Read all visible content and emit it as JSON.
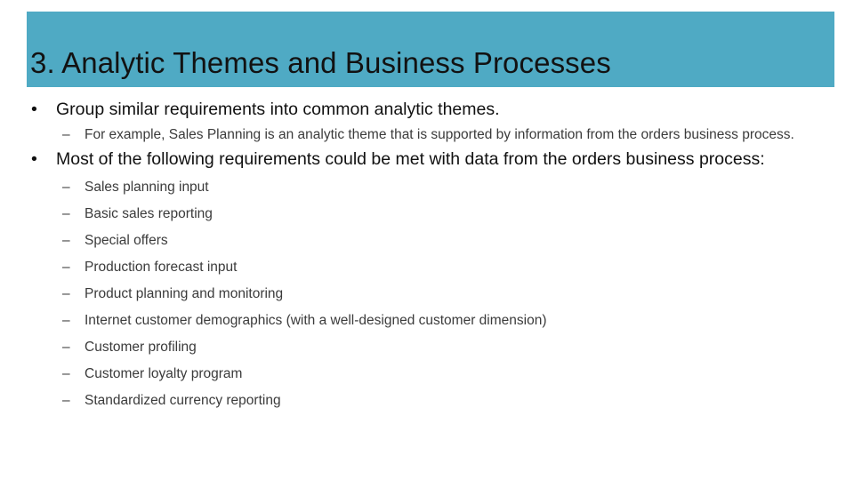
{
  "slide": {
    "title": "3. Analytic Themes and Business Processes",
    "theme_color": "#4faac4",
    "title_color": "#121212",
    "body_color": "#111111",
    "sub_body_color": "#3b3b3b",
    "bullet_marker": "•",
    "dash_marker": "–"
  },
  "content": {
    "bullet_1": "Group similar requirements into common analytic themes.",
    "bullet_1_sub": "For example, Sales Planning is an analytic theme that is supported by information from the orders business process.",
    "bullet_2": "Most of the following requirements could be met with data from the orders business process:",
    "items": [
      "Sales planning input",
      "Basic sales reporting",
      "Special offers",
      "Production forecast input",
      "Product planning and monitoring",
      "Internet customer demographics (with a well-designed customer dimension)",
      "Customer profiling",
      "Customer loyalty program",
      "Standardized currency reporting"
    ]
  }
}
